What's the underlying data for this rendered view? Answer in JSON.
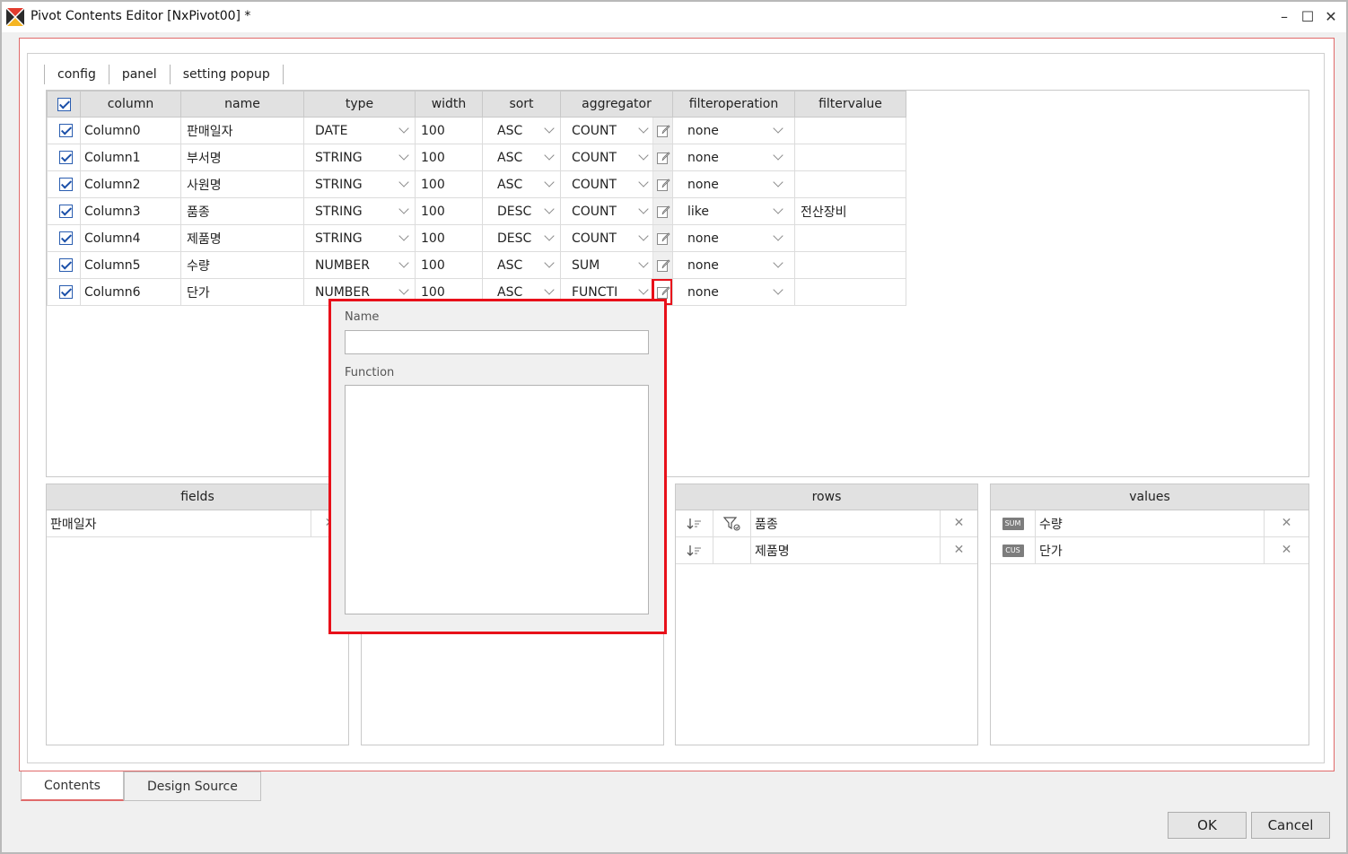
{
  "window": {
    "title": "Pivot Contents Editor [NxPivot00] *",
    "minimize": "–",
    "maximize": "☐",
    "close": "✕"
  },
  "sub_tabs": [
    "config",
    "panel",
    "setting popup"
  ],
  "grid": {
    "headers": [
      "column",
      "name",
      "type",
      "width",
      "sort",
      "aggregator",
      "filteroperation",
      "filtervalue"
    ],
    "rows": [
      {
        "column": "Column0",
        "name": "판매일자",
        "type": "DATE",
        "width": "100",
        "sort": "ASC",
        "aggregator": "COUNT",
        "filteroperation": "none",
        "filtervalue": ""
      },
      {
        "column": "Column1",
        "name": "부서명",
        "type": "STRING",
        "width": "100",
        "sort": "ASC",
        "aggregator": "COUNT",
        "filteroperation": "none",
        "filtervalue": ""
      },
      {
        "column": "Column2",
        "name": "사원명",
        "type": "STRING",
        "width": "100",
        "sort": "ASC",
        "aggregator": "COUNT",
        "filteroperation": "none",
        "filtervalue": ""
      },
      {
        "column": "Column3",
        "name": "품종",
        "type": "STRING",
        "width": "100",
        "sort": "DESC",
        "aggregator": "COUNT",
        "filteroperation": "like",
        "filtervalue": "전산장비"
      },
      {
        "column": "Column4",
        "name": "제품명",
        "type": "STRING",
        "width": "100",
        "sort": "DESC",
        "aggregator": "COUNT",
        "filteroperation": "none",
        "filtervalue": ""
      },
      {
        "column": "Column5",
        "name": "수량",
        "type": "NUMBER",
        "width": "100",
        "sort": "ASC",
        "aggregator": "SUM",
        "filteroperation": "none",
        "filtervalue": ""
      },
      {
        "column": "Column6",
        "name": "단가",
        "type": "NUMBER",
        "width": "100",
        "sort": "ASC",
        "aggregator": "FUNCTI",
        "filteroperation": "none",
        "filtervalue": ""
      }
    ]
  },
  "panels": {
    "fields": {
      "title": "fields",
      "items": [
        "판매일자"
      ]
    },
    "rows": {
      "title": "rows",
      "items": [
        "품종",
        "제품명"
      ]
    },
    "values": {
      "title": "values",
      "items": [
        {
          "badge": "SUM",
          "label": "수량"
        },
        {
          "badge": "CUS",
          "label": "단가"
        }
      ]
    }
  },
  "popup": {
    "name_label": "Name",
    "name_value": "",
    "function_label": "Function",
    "function_value": ""
  },
  "bottom_tabs": [
    "Contents",
    "Design Source"
  ],
  "buttons": {
    "ok": "OK",
    "cancel": "Cancel"
  },
  "icons": {
    "remove": "✕",
    "sort": "sort-desc-icon",
    "filter": "filter-icon",
    "edit": "pencil-icon"
  },
  "colors": {
    "highlight": "#e8101a",
    "checkbox": "#2a5db0"
  }
}
